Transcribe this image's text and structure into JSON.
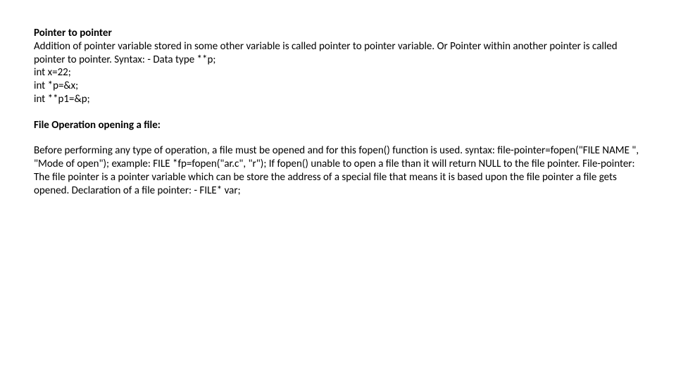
{
  "section1": {
    "heading": "Pointer to pointer",
    "para": "Addition of pointer variable stored in some other variable is called pointer to pointer variable. Or Pointer within another pointer is called pointer to pointer. Syntax: - Data type **p;",
    "code1": "int x=22;",
    "code2": "int *p=&x;",
    "code3": " int **p1=&p;"
  },
  "section2": {
    "heading": "File Operation opening a file:"
  },
  "section3": {
    "para": "Before performing any type of operation, a file must be opened and for this fopen() function is used. syntax: file-pointer=fopen(\"FILE NAME \", \"Mode of open\"); example: FILE *fp=fopen(\"ar.c\", \"r\"); If fopen() unable to open a file than it will return NULL to the file pointer. File-pointer: The file pointer is a pointer variable which can be store the address of a special file that means it is based upon the file pointer a file gets opened. Declaration of a file pointer: - FILE* var;"
  }
}
